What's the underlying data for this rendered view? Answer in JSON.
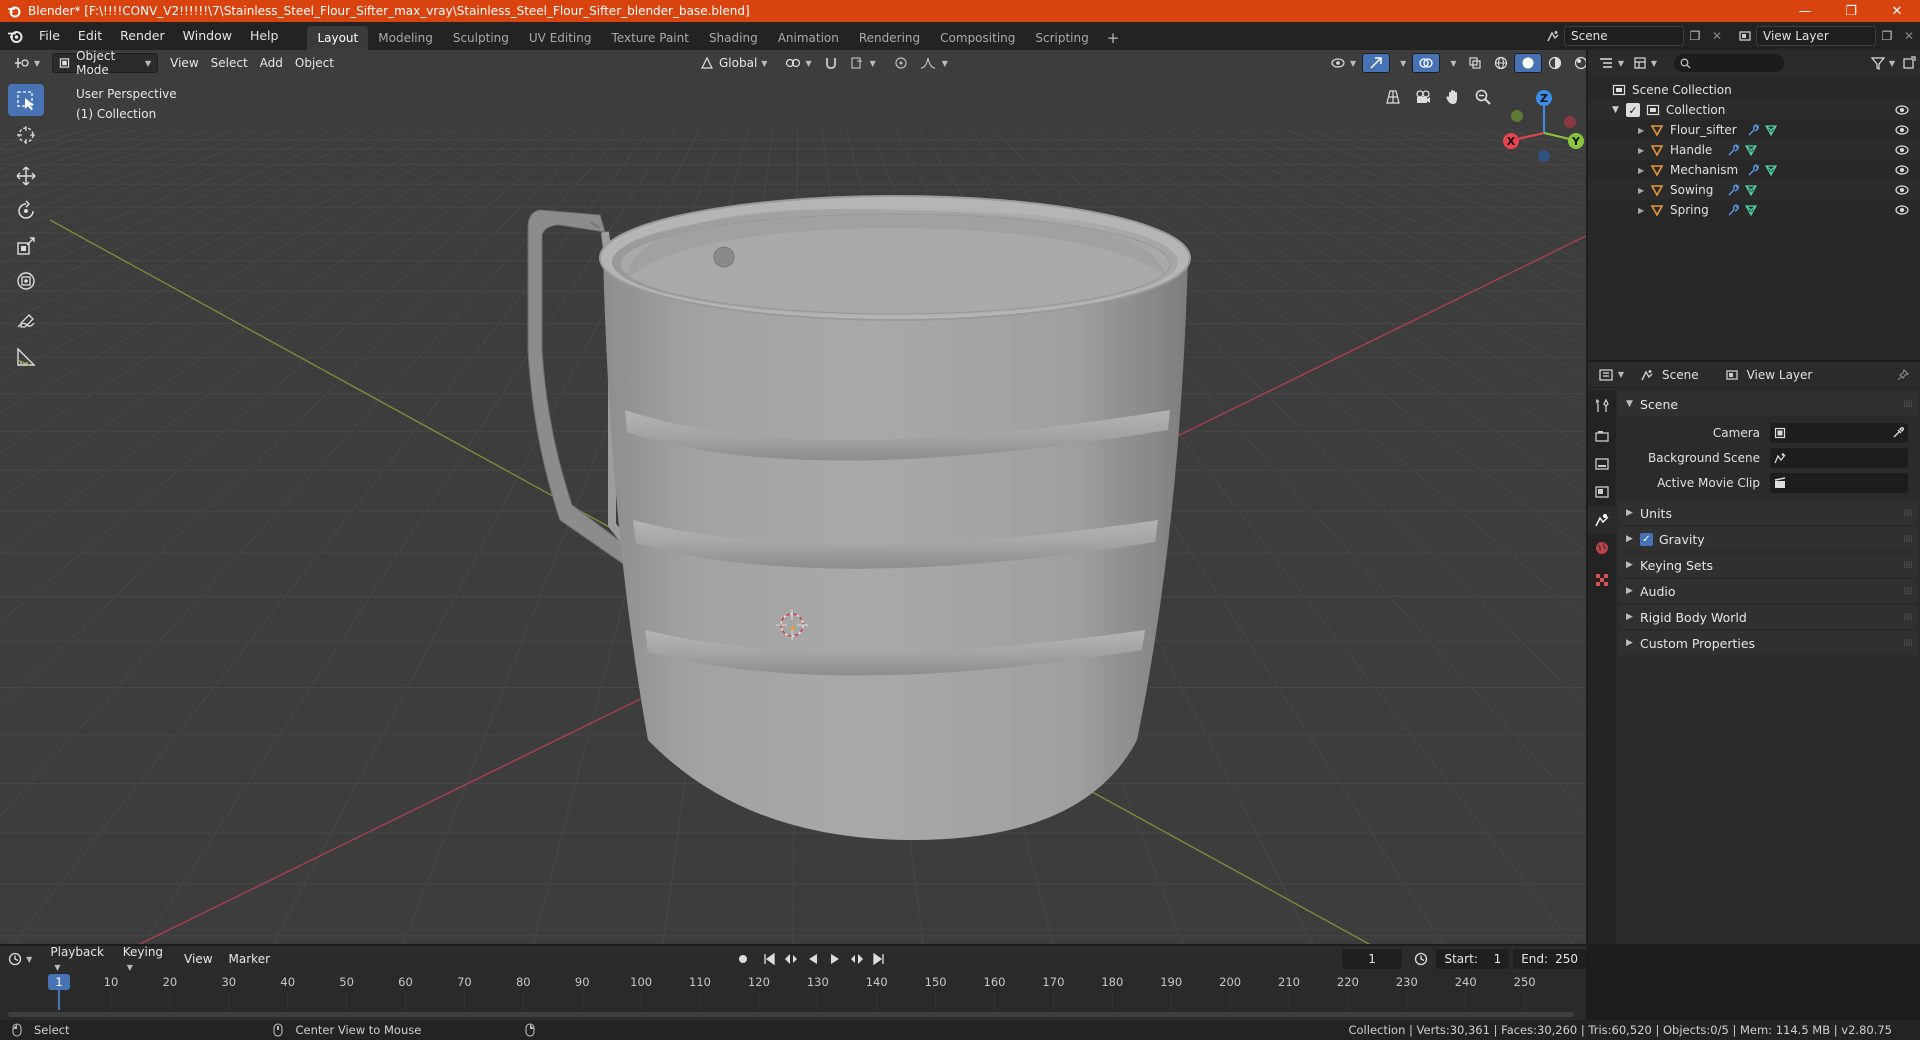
{
  "window": {
    "title": "Blender* [F:\\!!!!CONV_V2!!!!!!\\7\\Stainless_Steel_Flour_Sifter_max_vray\\Stainless_Steel_Flour_Sifter_blender_base.blend]",
    "min": "—",
    "max": "❐",
    "close": "✕"
  },
  "menu": [
    "File",
    "Edit",
    "Render",
    "Window",
    "Help"
  ],
  "workspaces": [
    "Layout",
    "Modeling",
    "Sculpting",
    "UV Editing",
    "Texture Paint",
    "Shading",
    "Animation",
    "Rendering",
    "Compositing",
    "Scripting"
  ],
  "active_workspace": "Layout",
  "scene_name": "Scene",
  "view_layer_name": "View Layer",
  "viewport": {
    "mode": "Object Mode",
    "menus": [
      "View",
      "Select",
      "Add",
      "Object"
    ],
    "transform_orientation": "Global",
    "info_line1": "User Perspective",
    "info_line2": "(1) Collection",
    "gizmo": {
      "x": "X",
      "y": "Y",
      "z": "Z"
    }
  },
  "outliner": {
    "root": "Scene Collection",
    "collection": "Collection",
    "objects": [
      "Flour_sifter",
      "Handle",
      "Mechanism",
      "Sowing",
      "Spring"
    ]
  },
  "properties": {
    "header_scene": "Scene",
    "header_view_layer": "View Layer",
    "panel_scene": "Scene",
    "camera_label": "Camera",
    "background_scene_label": "Background Scene",
    "active_movie_clip_label": "Active Movie Clip",
    "panels": [
      "Units",
      "Gravity",
      "Keying Sets",
      "Audio",
      "Rigid Body World",
      "Custom Properties"
    ],
    "gravity_checked": true
  },
  "timeline": {
    "menus": [
      "Playback",
      "Keying",
      "View",
      "Marker"
    ],
    "current_frame": "1",
    "start_label": "Start:",
    "start_value": "1",
    "end_label": "End:",
    "end_value": "250",
    "ruler_marks": [
      "1",
      "10",
      "20",
      "30",
      "40",
      "50",
      "60",
      "70",
      "80",
      "90",
      "100",
      "110",
      "120",
      "130",
      "140",
      "150",
      "160",
      "170",
      "180",
      "190",
      "200",
      "210",
      "220",
      "230",
      "240",
      "250"
    ]
  },
  "status": {
    "left_action": "Select",
    "mid_action": "Center View to Mouse",
    "stats": "Collection | Verts:30,361 | Faces:30,260 | Tris:60,520 | Objects:0/5 | Mem: 114.5 MB | v2.80.75"
  },
  "colors": {
    "titlebar": "#d9430f",
    "accent_blue": "#4772b3",
    "axis_x": "#e8434f",
    "axis_y": "#8cc63e",
    "axis_z": "#3b8ee8",
    "object_orange": "#e8973a"
  }
}
